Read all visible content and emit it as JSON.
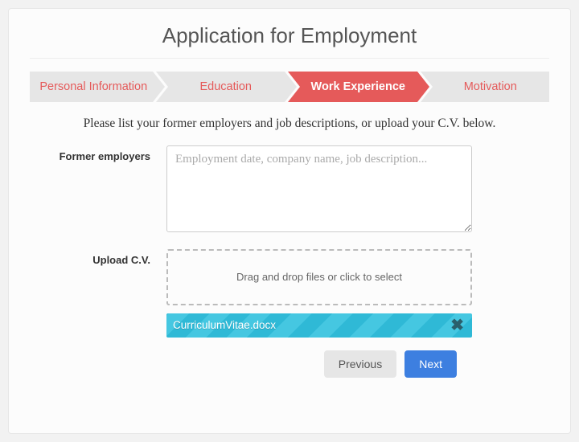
{
  "title": "Application for Employment",
  "steps": [
    {
      "label": "Personal Information",
      "active": false
    },
    {
      "label": "Education",
      "active": false
    },
    {
      "label": "Work Experience",
      "active": true
    },
    {
      "label": "Motivation",
      "active": false
    }
  ],
  "instructions": "Please list your former employers and job descriptions, or upload your C.V. below.",
  "form": {
    "former_employers": {
      "label": "Former employers",
      "placeholder": "Employment date, company name, job description...",
      "value": ""
    },
    "upload_cv": {
      "label": "Upload C.V.",
      "dropzone_text": "Drag and drop files or click to select",
      "uploaded_file": "CurriculumVitae.docx"
    }
  },
  "buttons": {
    "previous": "Previous",
    "next": "Next"
  }
}
